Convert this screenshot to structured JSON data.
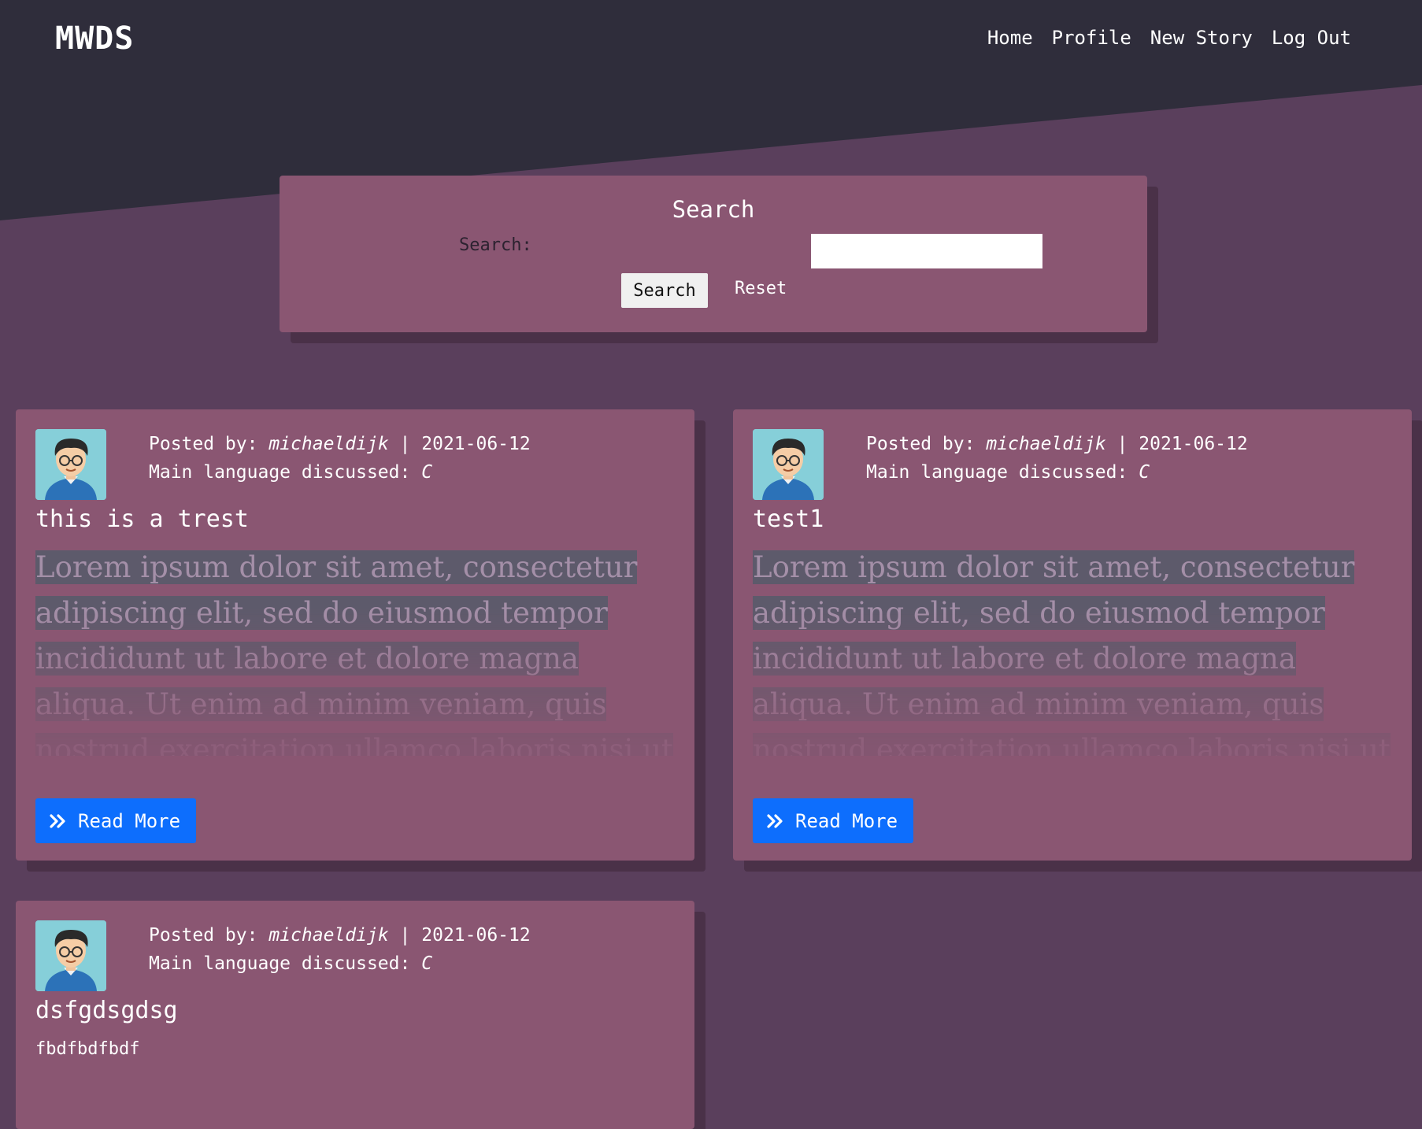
{
  "brand": "MWDS",
  "nav": [
    "Home",
    "Profile",
    "New Story",
    "Log Out"
  ],
  "search": {
    "title": "Search",
    "label": "Search:",
    "input_value": "",
    "search_button": "Search",
    "reset_button": "Reset"
  },
  "labels": {
    "posted_by": "Posted by:",
    "separator": "|",
    "main_language": "Main language discussed:",
    "read_more": "Read More"
  },
  "posts": [
    {
      "author": "michaeldijk",
      "date": "2021-06-12",
      "language": "C",
      "title": "this is a trest",
      "excerpt": "Lorem ipsum dolor sit amet, consectetur adipiscing elit, sed do eiusmod tempor incididunt ut labore et dolore magna aliqua. Ut enim ad minim veniam, quis nostrud exercitation ullamco laboris nisi ut aliquip ex"
    },
    {
      "author": "michaeldijk",
      "date": "2021-06-12",
      "language": "C",
      "title": "test1",
      "excerpt": "Lorem ipsum dolor sit amet, consectetur adipiscing elit, sed do eiusmod tempor incididunt ut labore et dolore magna aliqua. Ut enim ad minim veniam, quis nostrud exercitation ullamco laboris nisi ut aliquip ex"
    },
    {
      "author": "michaeldijk",
      "date": "2021-06-12",
      "language": "C",
      "title": "dsfgdsgdsg",
      "body": "fbdfbdfbdf"
    }
  ],
  "colors": {
    "header_bg": "#2f2d3b",
    "page_bg": "#5a3f5c",
    "card_bg": "#8a5672",
    "button_primary": "#0d6efd"
  }
}
